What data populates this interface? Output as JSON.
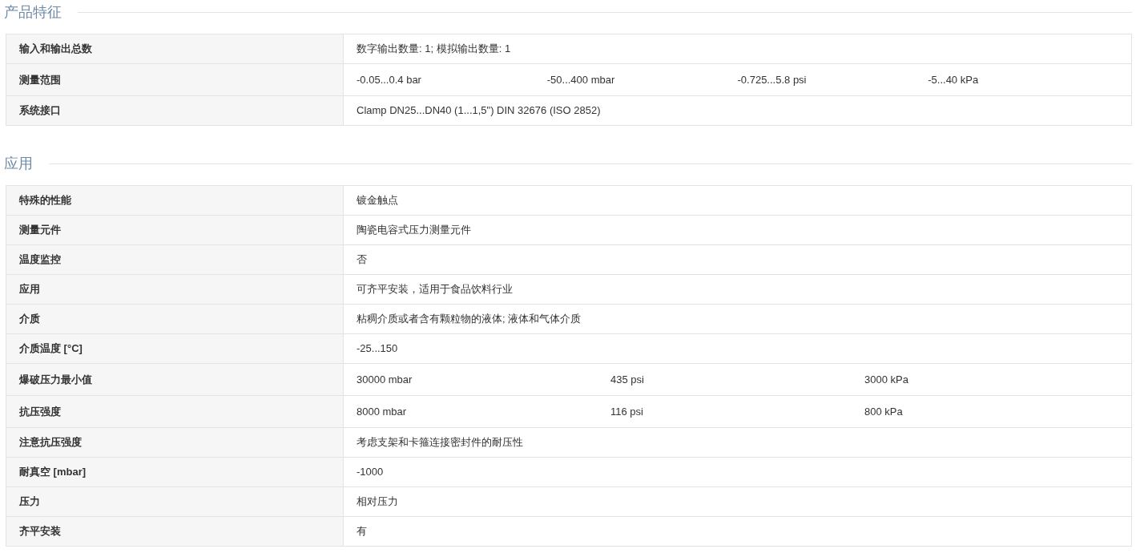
{
  "sections": [
    {
      "title": "产品特征",
      "rows": [
        {
          "label": "输入和输出总数",
          "values": [
            "数字输出数量: 1; 模拟输出数量: 1"
          ]
        },
        {
          "label": "测量范围",
          "values": [
            "-0.05...0.4 bar",
            "-50...400 mbar",
            "-0.725...5.8 psi",
            "-5...40 kPa"
          ]
        },
        {
          "label": "系统接口",
          "values": [
            "Clamp DN25...DN40 (1...1,5\") DIN 32676 (ISO 2852)"
          ]
        }
      ]
    },
    {
      "title": "应用",
      "rows": [
        {
          "label": "特殊的性能",
          "values": [
            "镀金触点"
          ]
        },
        {
          "label": "测量元件",
          "values": [
            "陶瓷电容式压力测量元件"
          ]
        },
        {
          "label": "温度监控",
          "values": [
            "否"
          ]
        },
        {
          "label": "应用",
          "values": [
            "可齐平安装，适用于食品饮料行业"
          ]
        },
        {
          "label": "介质",
          "values": [
            "粘稠介质或者含有颗粒物的液体; 液体和气体介质"
          ]
        },
        {
          "label": "介质温度 [°C]",
          "values": [
            "-25...150"
          ]
        },
        {
          "label": "爆破压力最小值",
          "values": [
            "30000 mbar",
            "435 psi",
            "3000 kPa"
          ]
        },
        {
          "label": "抗压强度",
          "values": [
            "8000 mbar",
            "116 psi",
            "800 kPa"
          ]
        },
        {
          "label": "注意抗压强度",
          "values": [
            "考虑支架和卡箍连接密封件的耐压性"
          ]
        },
        {
          "label": "耐真空 [mbar]",
          "values": [
            "-1000"
          ]
        },
        {
          "label": "压力",
          "values": [
            "相对压力"
          ]
        },
        {
          "label": "齐平安装",
          "values": [
            "有"
          ]
        }
      ]
    }
  ]
}
